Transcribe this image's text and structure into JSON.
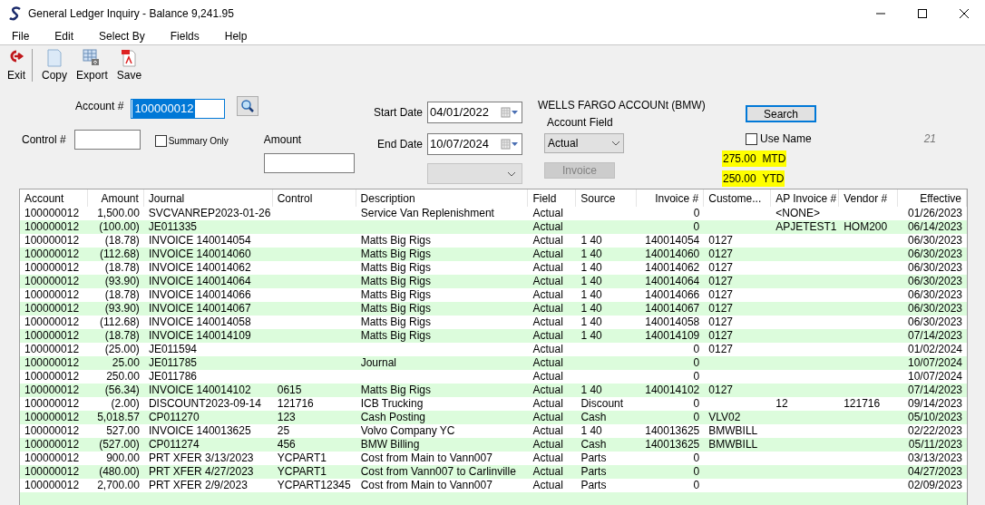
{
  "window": {
    "title": "General Ledger Inquiry - Balance 9,241.95"
  },
  "menu": [
    "File",
    "Edit",
    "Select By",
    "Fields",
    "Help"
  ],
  "toolbar": [
    {
      "kind": "exit",
      "label": "Exit"
    },
    {
      "kind": "copy",
      "label": "Copy"
    },
    {
      "kind": "export",
      "label": "Export"
    },
    {
      "kind": "save",
      "label": "Save"
    }
  ],
  "form": {
    "account": {
      "label": "Account #",
      "value": "100000012",
      "text_selected": true
    },
    "control": {
      "label": "Control #"
    },
    "summary_only": {
      "label": "Summary Only",
      "checked": false
    },
    "amount": {
      "label": "Amount"
    },
    "start_date": {
      "label": "Start Date",
      "value": "04/01/2022"
    },
    "end_date": {
      "label": "End Date",
      "value": "10/07/2024"
    },
    "extra_dropdown": {
      "disabled": true
    },
    "account_name": "WELLS FARGO ACCOUNt (BMW)",
    "account_field": {
      "label": "Account Field",
      "value": "Actual"
    },
    "invoice_button": {
      "label": "Invoice",
      "disabled": true
    },
    "search_button": {
      "label": "Search",
      "focused": true
    },
    "use_name": {
      "label": "Use Name",
      "checked": false
    },
    "count": "21",
    "totals": [
      {
        "amount": "275.00",
        "label": "MTD",
        "highlighted": true
      },
      {
        "amount": "250.00",
        "label": "YTD",
        "highlighted": true
      }
    ]
  },
  "table": {
    "columns": [
      "Account",
      "Amount",
      "Journal",
      "Control",
      "Description",
      "Field",
      "Source",
      "Invoice #",
      "Custome...",
      "AP Invoice #",
      "Vendor #",
      "Effective"
    ],
    "rows": [
      [
        "100000012",
        "1,500.00",
        "SVCVANREP2023-01-26",
        "",
        "Service Van Replenishment",
        "Actual",
        "",
        "0",
        "",
        "<NONE>",
        "",
        "01/26/2023"
      ],
      [
        "100000012",
        "(100.00)",
        "JE011335",
        "",
        "",
        "Actual",
        "",
        "0",
        "",
        "APJETEST1",
        "HOM200",
        "06/14/2023"
      ],
      [
        "100000012",
        "(18.78)",
        "INVOICE 140014054",
        "",
        "Matts Big Rigs",
        "Actual",
        "1 40",
        "140014054",
        "0127",
        "",
        "",
        "06/30/2023"
      ],
      [
        "100000012",
        "(112.68)",
        "INVOICE 140014060",
        "",
        "Matts Big Rigs",
        "Actual",
        "1 40",
        "140014060",
        "0127",
        "",
        "",
        "06/30/2023"
      ],
      [
        "100000012",
        "(18.78)",
        "INVOICE 140014062",
        "",
        "Matts Big Rigs",
        "Actual",
        "1 40",
        "140014062",
        "0127",
        "",
        "",
        "06/30/2023"
      ],
      [
        "100000012",
        "(93.90)",
        "INVOICE 140014064",
        "",
        "Matts Big Rigs",
        "Actual",
        "1 40",
        "140014064",
        "0127",
        "",
        "",
        "06/30/2023"
      ],
      [
        "100000012",
        "(18.78)",
        "INVOICE 140014066",
        "",
        "Matts Big Rigs",
        "Actual",
        "1 40",
        "140014066",
        "0127",
        "",
        "",
        "06/30/2023"
      ],
      [
        "100000012",
        "(93.90)",
        "INVOICE 140014067",
        "",
        "Matts Big Rigs",
        "Actual",
        "1 40",
        "140014067",
        "0127",
        "",
        "",
        "06/30/2023"
      ],
      [
        "100000012",
        "(112.68)",
        "INVOICE 140014058",
        "",
        "Matts Big Rigs",
        "Actual",
        "1 40",
        "140014058",
        "0127",
        "",
        "",
        "06/30/2023"
      ],
      [
        "100000012",
        "(18.78)",
        "INVOICE 140014109",
        "",
        "Matts Big Rigs",
        "Actual",
        "1 40",
        "140014109",
        "0127",
        "",
        "",
        "07/14/2023"
      ],
      [
        "100000012",
        "(25.00)",
        "JE011594",
        "",
        "",
        "Actual",
        "",
        "0",
        "0127",
        "",
        "",
        "01/02/2024"
      ],
      [
        "100000012",
        "25.00",
        "JE011785",
        "",
        "Journal",
        "Actual",
        "",
        "0",
        "",
        "",
        "",
        "10/07/2024"
      ],
      [
        "100000012",
        "250.00",
        "JE011786",
        "",
        "",
        "Actual",
        "",
        "0",
        "",
        "",
        "",
        "10/07/2024"
      ],
      [
        "100000012",
        "(56.34)",
        "INVOICE 140014102",
        "0615",
        "Matts Big Rigs",
        "Actual",
        "1 40",
        "140014102",
        "0127",
        "",
        "",
        "07/14/2023"
      ],
      [
        "100000012",
        "(2.00)",
        "DISCOUNT2023-09-14",
        "121716",
        "ICB Trucking",
        "Actual",
        "Discount",
        "0",
        "",
        "12",
        "121716",
        "09/14/2023"
      ],
      [
        "100000012",
        "5,018.57",
        "CP011270",
        "123",
        "Cash Posting",
        "Actual",
        "Cash",
        "0",
        "VLV02",
        "",
        "",
        "05/10/2023"
      ],
      [
        "100000012",
        "527.00",
        "INVOICE 140013625",
        "25",
        "Volvo Company YC",
        "Actual",
        "1 40",
        "140013625",
        "BMWBILL",
        "",
        "",
        "02/22/2023"
      ],
      [
        "100000012",
        "(527.00)",
        "CP011274",
        "456",
        "BMW Billing",
        "Actual",
        "Cash",
        "140013625",
        "BMWBILL",
        "",
        "",
        "05/11/2023"
      ],
      [
        "100000012",
        "900.00",
        "PRT XFER 3/13/2023",
        "YCPART1",
        "Cost from Main to Vann007",
        "Actual",
        "Parts",
        "0",
        "",
        "",
        "",
        "03/13/2023"
      ],
      [
        "100000012",
        "(480.00)",
        "PRT XFER 4/27/2023",
        "YCPART1",
        "Cost from Vann007 to Carlinville",
        "Actual",
        "Parts",
        "0",
        "",
        "",
        "",
        "04/27/2023"
      ],
      [
        "100000012",
        "2,700.00",
        "PRT XFER 2/9/2023",
        "YCPART12345",
        "Cost from Main to Vann007",
        "Actual",
        "Parts",
        "0",
        "",
        "",
        "",
        "02/09/2023"
      ]
    ]
  }
}
